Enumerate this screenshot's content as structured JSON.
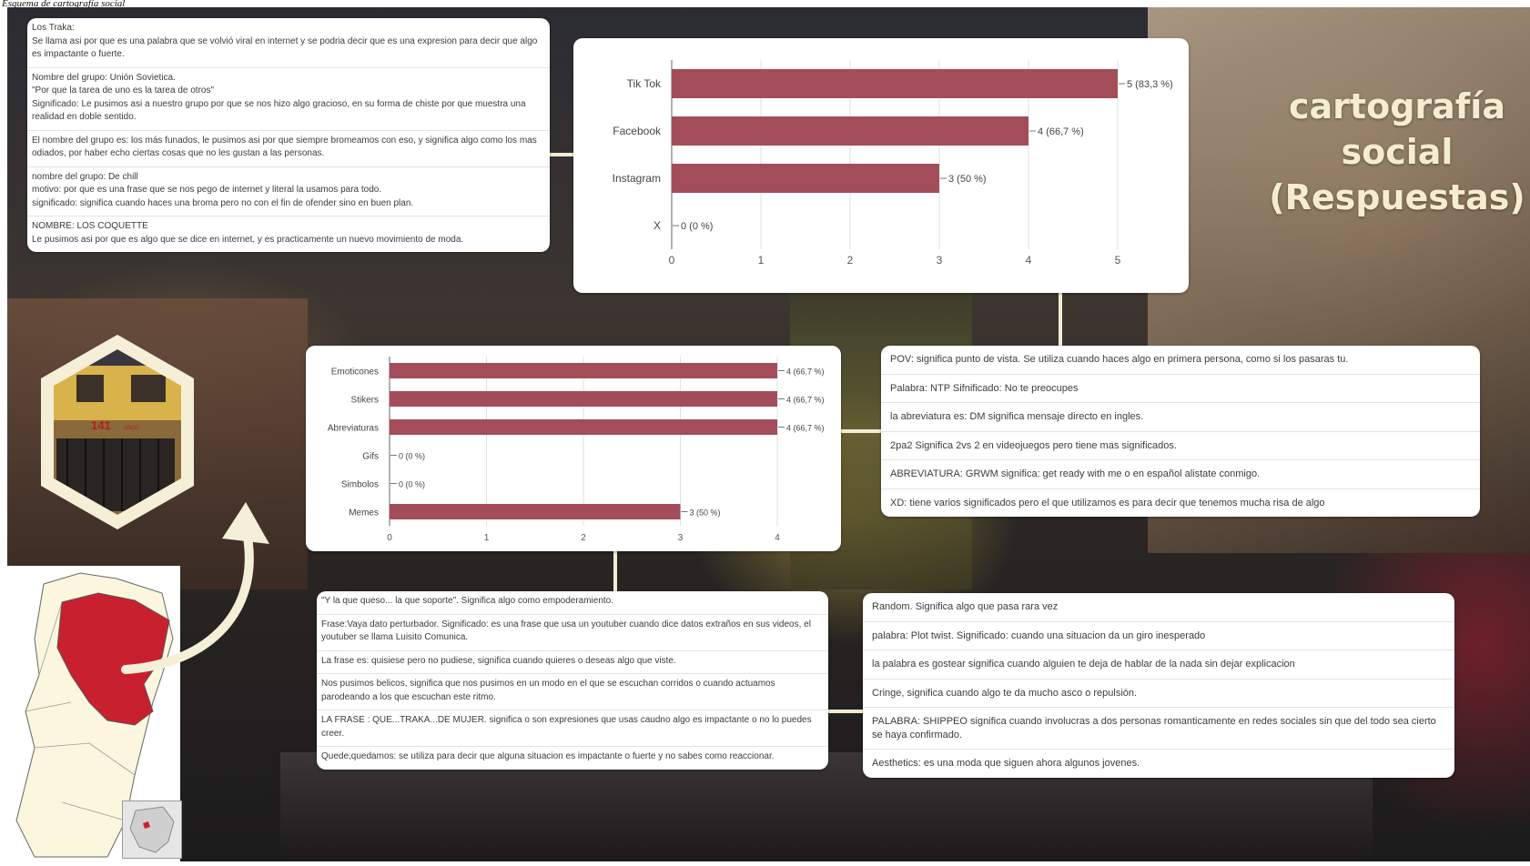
{
  "caption": "Esquema de cartografía social",
  "title": {
    "line1": "cartografía",
    "line2": "social",
    "line3": "(Respuestas)"
  },
  "panel_groups": {
    "entries": [
      "Los Traka:\nSe llama asi por que es una palabra que se volvió viral en internet y se podria decir que es una expresion para decir que algo es impactante o fuerte.",
      "Nombre del grupo: Unión Sovietica.\n\"Por que la tarea de uno es la tarea de otros\"\nSignificado: Le pusimos asi a nuestro grupo por que se nos hizo algo gracioso, en su forma de chiste por que muestra una realidad en doble sentido.",
      "El nombre del grupo es: los más funados, le pusimos asi por que siempre bromeamos con eso, y significa algo como los mas odiados, por haber echo ciertas cosas que no les gustan a las personas.",
      "nombre del grupo: De chill\nmotivo: por que es una frase que se nos pego de internet y literal la usamos para todo.\nsignificado: significa cuando haces una broma pero no con el fin de ofender sino en buen plan.",
      "NOMBRE: LOS COQUETTE\nLe pusimos asi por que es algo que se dice en internet, y es practicamente un nuevo movimiento de moda."
    ]
  },
  "panel_words_right": {
    "entries": [
      "POV: significa punto de vista. Se utiliza cuando haces algo en primera persona, como si los pasaras tu.",
      "Palabra: NTP Sifnificado: No te preocupes",
      "la abreviatura es: DM significa mensaje directo en ingles.",
      "2pa2 Significa 2vs 2 en videojuegos pero tiene mas significados.",
      "ABREVIATURA: GRWM significa: get ready with me o en español alistate conmigo.",
      "XD: tiene varios significados pero el que utilizamos es para decir que tenemos mucha risa de algo"
    ]
  },
  "panel_phrases": {
    "entries": [
      "\"Y la que queso... la que soporte\". Significa algo como empoderamiento.",
      "Frase:Vaya dato perturbador. Significado: es una frase que usa un youtuber cuando dice datos extraños en sus videos, el youtuber se llama Luisito Comunica.",
      "La frase es: quisiese pero no pudiese, significa cuando quieres o deseas algo que viste.",
      "Nos pusimos belicos, significa que nos pusimos en un modo en el que se escuchan corridos o cuando actuamos parodeando a los que escuchan este ritmo.",
      "LA FRASE : QUE...TRAKA...DE MUJER. significa o son expresiones que usas caudno algo es impactante o no lo puedes creer.",
      "Quede,quedamos: se utiliza para decir que alguna situacion es impactante o fuerte y no sabes como reaccionar."
    ]
  },
  "panel_words_bottom": {
    "entries": [
      "Random. Significa algo que pasa rara vez",
      "palabra: Plot twist. Significado: cuando una situacion da un giro inesperado",
      "la palabra es gostear significa cuando alguien te deja de hablar de la nada sin dejar explicacion",
      "Cringe, significa cuando algo te da mucho asco o repulsión.",
      "PALABRA: SHIPPEO significa cuando involucras a dos personas romanticamente en redes sociales sin que del todo sea cierto se haya confirmado.",
      "Aesthetics: es una moda que siguen ahora algunos jovenes."
    ]
  },
  "hex_photo": {
    "sign_text": "141",
    "sign_small": "AÑOS"
  },
  "colors": {
    "bar": "#a34d5a",
    "title": "#f6ecd0",
    "map_region": "#c9202f",
    "map_base": "#fbf6dd",
    "connector": "#f3ecd4"
  },
  "chart_data": [
    {
      "type": "bar",
      "orientation": "horizontal",
      "categories": [
        "Tik Tok",
        "Facebook",
        "Instagram",
        "X"
      ],
      "values": [
        5,
        4,
        3,
        0
      ],
      "labels": [
        "5 (83,3 %)",
        "4 (66,7 %)",
        "3 (50 %)",
        "0 (0 %)"
      ],
      "xlim": [
        0,
        5
      ],
      "xticks": [
        "0",
        "1",
        "2",
        "3",
        "4",
        "5"
      ],
      "grid": true
    },
    {
      "type": "bar",
      "orientation": "horizontal",
      "categories": [
        "Emoticones",
        "Stikers",
        "Abreviaturas",
        "Gifs",
        "Simbolos",
        "Memes"
      ],
      "values": [
        4,
        4,
        4,
        0,
        0,
        3
      ],
      "labels": [
        "4 (66,7 %)",
        "4 (66,7 %)",
        "4 (66,7 %)",
        "0 (0 %)",
        "0 (0 %)",
        "3 (50 %)"
      ],
      "xlim": [
        0,
        4
      ],
      "xticks": [
        "0",
        "1",
        "2",
        "3",
        "4"
      ],
      "grid": true
    }
  ]
}
